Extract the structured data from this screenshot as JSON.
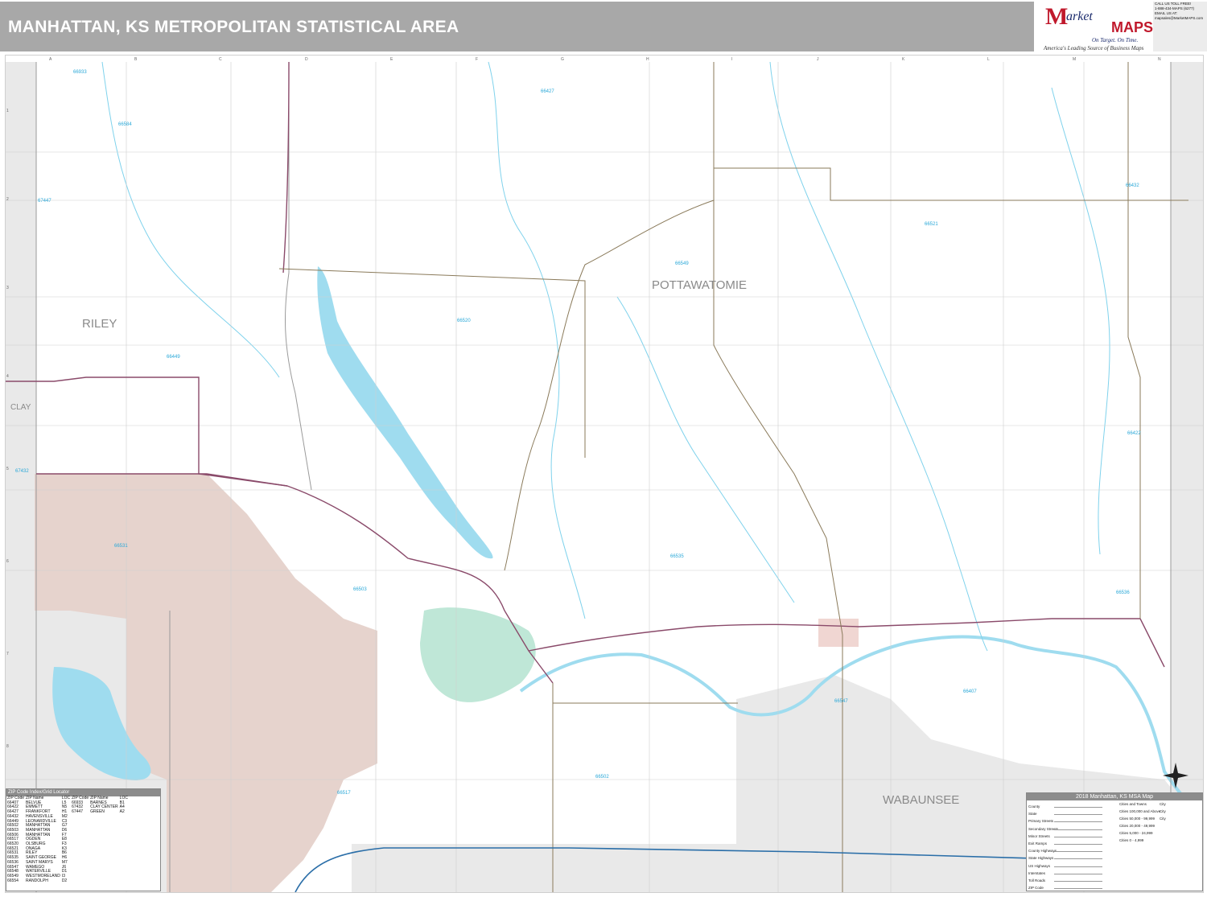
{
  "title": "MANHATTAN, KS METROPOLITAN STATISTICAL AREA",
  "logo": {
    "m": "M",
    "arket": "arket",
    "maps": "MAPS",
    "tagline": "On Target. On Time.",
    "subline": "America's Leading Source of Business Maps"
  },
  "contact": [
    "CALL US TOLL FREE!",
    "1-888-434-MAPS (6277)",
    "EMAIL US AT:",
    "mapsales@MarketMAPS.com"
  ],
  "grid": {
    "columns": [
      "A",
      "B",
      "C",
      "D",
      "E",
      "F",
      "G",
      "H",
      "I",
      "J",
      "K",
      "L",
      "M",
      "N"
    ],
    "rows": [
      "1",
      "2",
      "3",
      "4",
      "5",
      "6",
      "7",
      "8",
      "9"
    ]
  },
  "counties": {
    "riley": "RILEY",
    "pottawatomie": "POTTAWATOMIE",
    "clay": "CLAY",
    "wabaunsee": "WABAUNSEE"
  },
  "zip_labels": [
    "66933",
    "66427",
    "66584",
    "67447",
    "66432",
    "66521",
    "66549",
    "66520",
    "66449",
    "66422",
    "67432",
    "66531",
    "66536",
    "66503",
    "66535",
    "66547",
    "66407",
    "66502",
    "66517"
  ],
  "colors": {
    "water": "#9fdcef",
    "stream": "#7fd2ec",
    "fort_riley": "#e6d3cd",
    "outside_area": "#e9e9e9",
    "urban": "#bfe7d7",
    "primary_road": "#8a4a6a",
    "highway": "#2a6ea8",
    "road": "#b0b0b0"
  },
  "zip_index": {
    "title": "ZIP Code Index/Grid Locator",
    "headers": [
      "ZIP Code",
      "ZIP Name",
      "LOC",
      "ZIP Code",
      "ZIP Name",
      "LOC"
    ],
    "rows": [
      [
        "66407",
        "BELVUE",
        "L5",
        "66933",
        "BARNES",
        "B1"
      ],
      [
        "66422",
        "EMMETT",
        "N5",
        "67432",
        "CLAY CENTER",
        "A4"
      ],
      [
        "66427",
        "FRANKFORT",
        "H1",
        "67447",
        "GREEN",
        "A2"
      ],
      [
        "66432",
        "HAVENSVILLE",
        "M2",
        "",
        "",
        ""
      ],
      [
        "66449",
        "LEONARDVILLE",
        "C3",
        "",
        "",
        ""
      ],
      [
        "66502",
        "MANHATTAN",
        "G7",
        "",
        "",
        ""
      ],
      [
        "66503",
        "MANHATTAN",
        "D6",
        "",
        "",
        ""
      ],
      [
        "66506",
        "MANHATTAN",
        "F7",
        "",
        "",
        ""
      ],
      [
        "66517",
        "OGDEN",
        "E8",
        "",
        "",
        ""
      ],
      [
        "66520",
        "OLSBURG",
        "F3",
        "",
        "",
        ""
      ],
      [
        "66521",
        "ONAGA",
        "K3",
        "",
        "",
        ""
      ],
      [
        "66531",
        "RILEY",
        "B6",
        "",
        "",
        ""
      ],
      [
        "66535",
        "SAINT GEORGE",
        "H6",
        "",
        "",
        ""
      ],
      [
        "66536",
        "SAINT MARYS",
        "M7",
        "",
        "",
        ""
      ],
      [
        "66547",
        "WAMEGO",
        "J6",
        "",
        "",
        ""
      ],
      [
        "66548",
        "WATERVILLE",
        "D1",
        "",
        "",
        ""
      ],
      [
        "66549",
        "WESTMORELAND",
        "I3",
        "",
        "",
        ""
      ],
      [
        "66554",
        "RANDOLPH",
        "D2",
        "",
        "",
        ""
      ]
    ]
  },
  "legend": {
    "title": "2018 Manhattan, KS MSA Map",
    "rows": [
      "County",
      "State",
      "Primary Streets",
      "Secondary Streets",
      "Minor Streets",
      "Exit Ramps",
      "County Highways",
      "State Highways",
      "US Highways",
      "Interstates",
      "Toll Roads",
      "ZIP Code"
    ],
    "cities": [
      "Cities and Towns",
      "Cities 100,000 and Above",
      "Cities 50,000 - 99,999",
      "Cities 20,000 - 49,999",
      "Cities 5,000 - 24,999",
      "Cities 0 - 4,999"
    ],
    "city_marks": [
      "City",
      "City",
      "City",
      "",
      "",
      ""
    ]
  }
}
